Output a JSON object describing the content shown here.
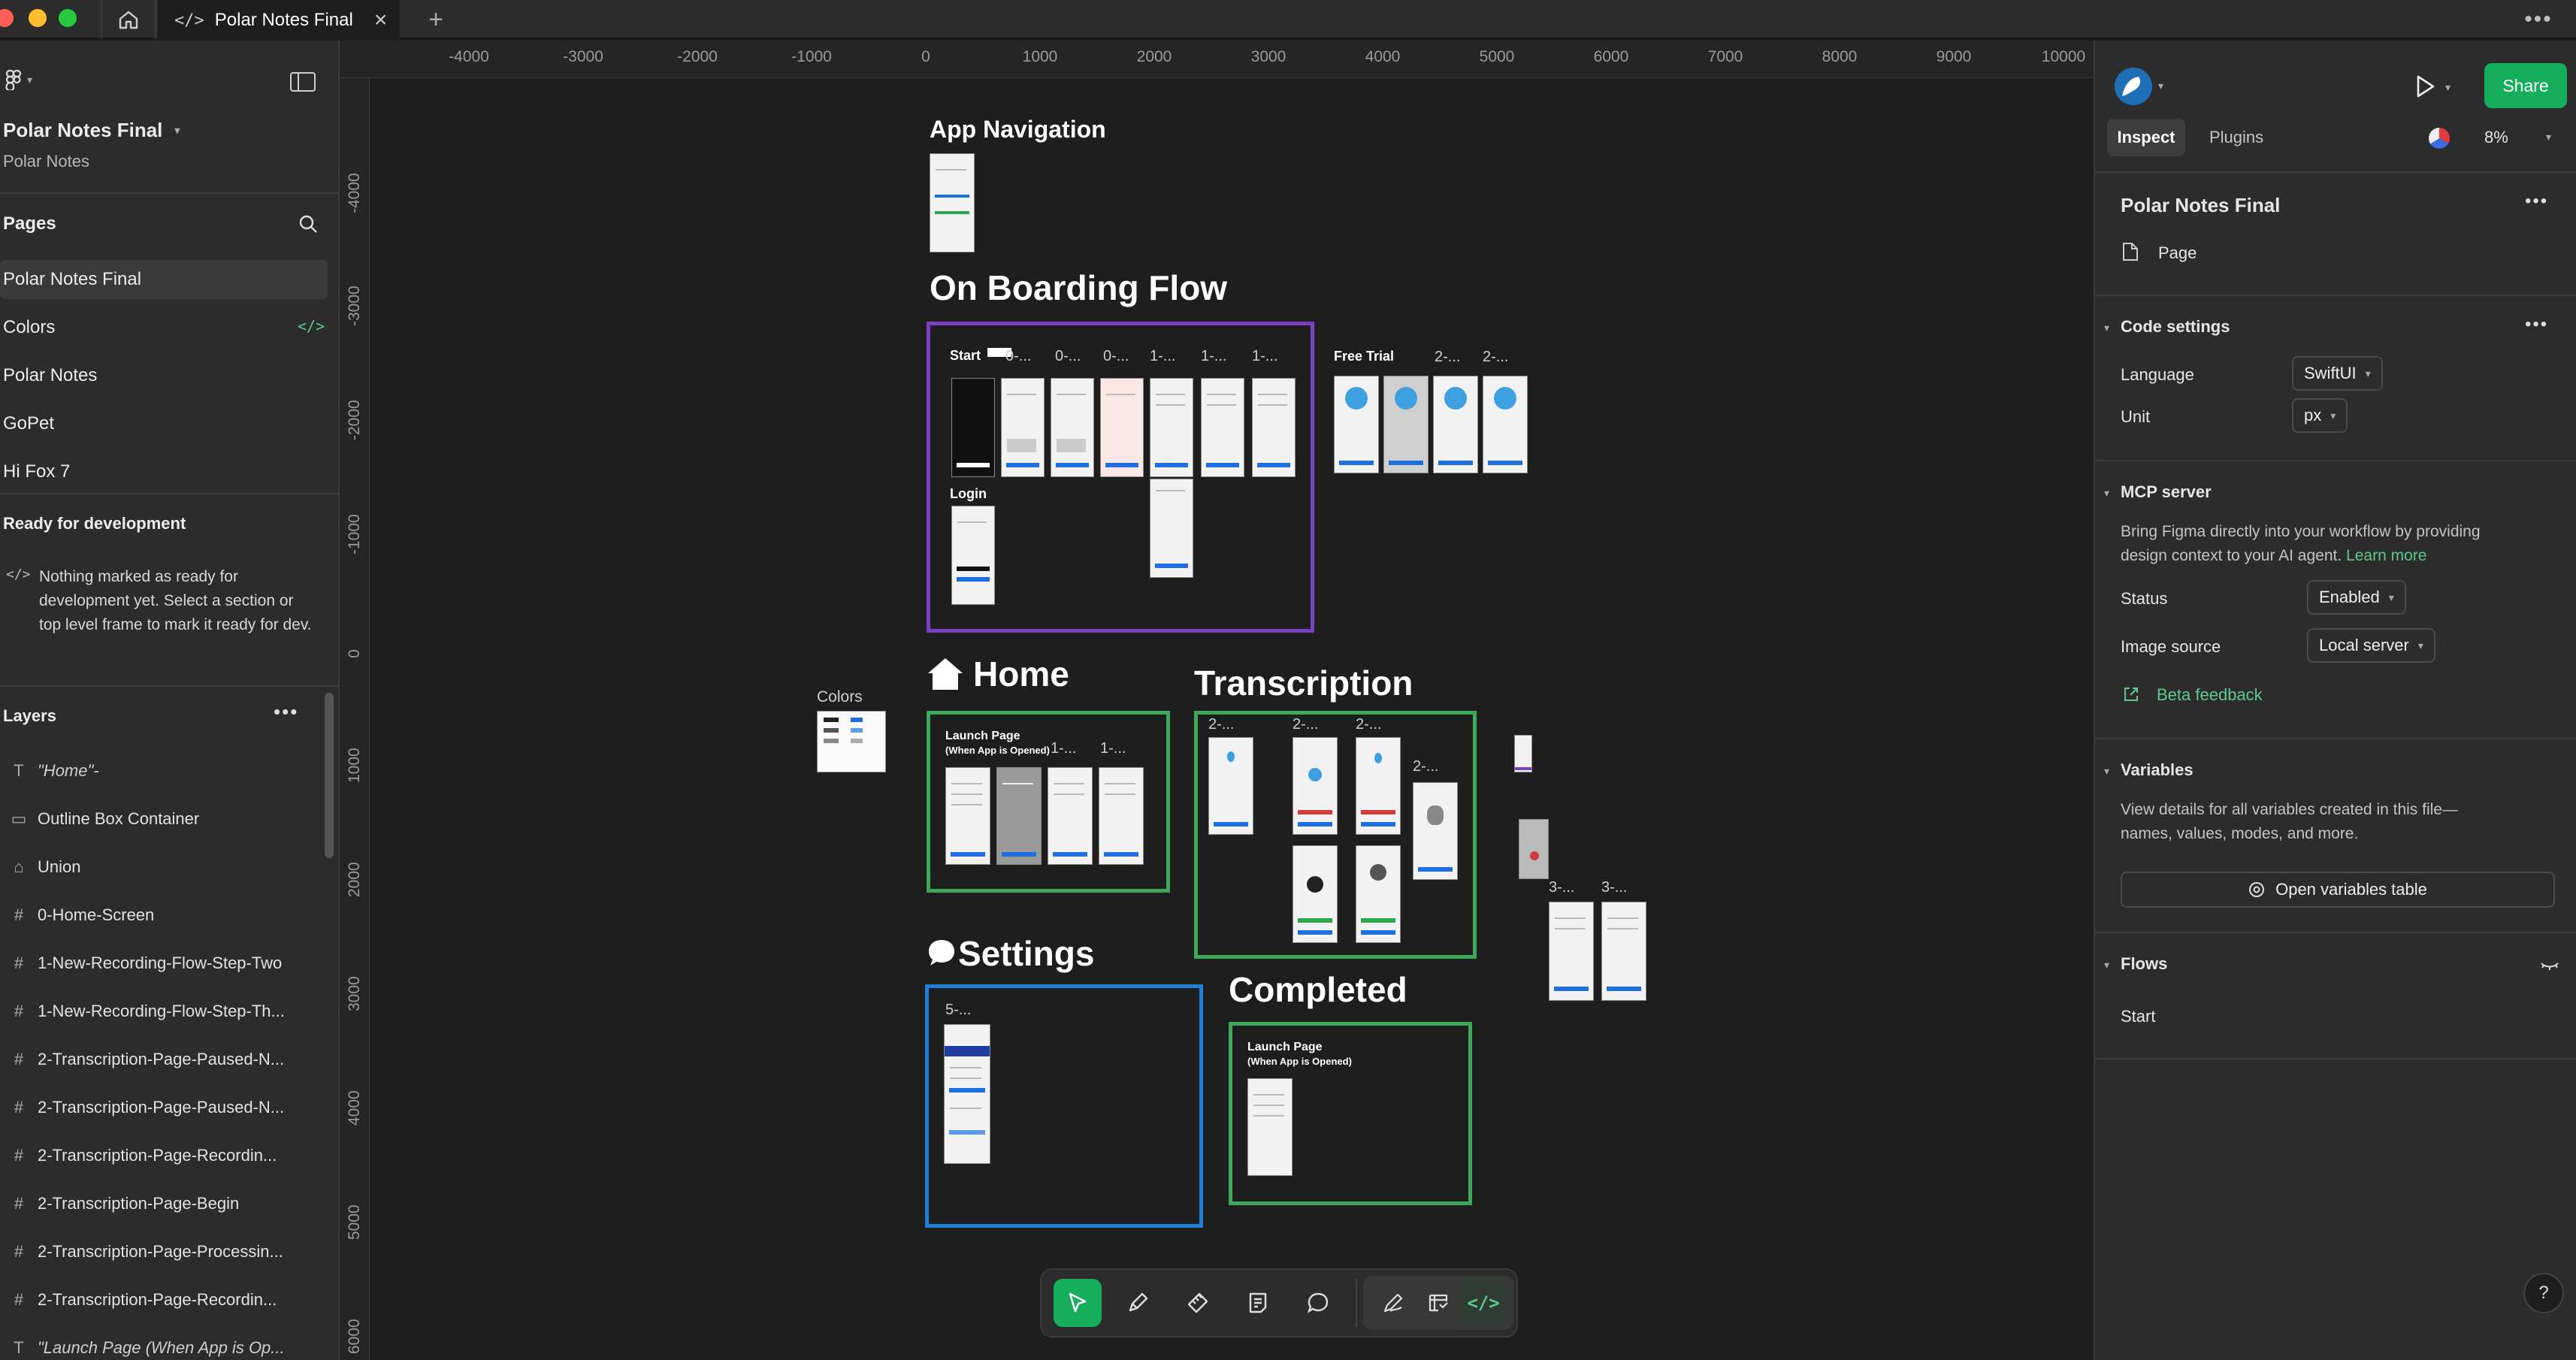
{
  "window": {
    "tab_title": "Polar Notes Final",
    "menu_dots": "•••"
  },
  "left": {
    "file_name": "Polar Notes Final",
    "project_name": "Polar Notes",
    "pages_header": "Pages",
    "pages": [
      "Polar Notes Final",
      "Colors",
      "Polar Notes",
      "GoPet",
      "Hi Fox 7"
    ],
    "ready_header": "Ready for development",
    "ready_message": "Nothing marked as ready for development yet. Select a section or top level frame to mark it ready for dev.",
    "layers_header": "Layers",
    "layers": [
      {
        "icon": "text-icon",
        "glyph": "T",
        "name": "\"Home\"-",
        "italic": true
      },
      {
        "icon": "rectangle-icon",
        "glyph": "▭",
        "name": "Outline Box Container",
        "italic": false
      },
      {
        "icon": "union-icon",
        "glyph": "⌂",
        "name": "Union",
        "italic": false
      },
      {
        "icon": "frame-icon",
        "glyph": "#",
        "name": "0-Home-Screen",
        "italic": false
      },
      {
        "icon": "frame-icon",
        "glyph": "#",
        "name": "1-New-Recording-Flow-Step-Two",
        "italic": false
      },
      {
        "icon": "frame-icon",
        "glyph": "#",
        "name": "1-New-Recording-Flow-Step-Th...",
        "italic": false
      },
      {
        "icon": "frame-icon",
        "glyph": "#",
        "name": "2-Transcription-Page-Paused-N...",
        "italic": false
      },
      {
        "icon": "frame-icon",
        "glyph": "#",
        "name": "2-Transcription-Page-Paused-N...",
        "italic": false
      },
      {
        "icon": "frame-icon",
        "glyph": "#",
        "name": "2-Transcription-Page-Recordin...",
        "italic": false
      },
      {
        "icon": "frame-icon",
        "glyph": "#",
        "name": "2-Transcription-Page-Begin",
        "italic": false
      },
      {
        "icon": "frame-icon",
        "glyph": "#",
        "name": "2-Transcription-Page-Processin...",
        "italic": false
      },
      {
        "icon": "frame-icon",
        "glyph": "#",
        "name": "2-Transcription-Page-Recordin...",
        "italic": false
      },
      {
        "icon": "text-icon",
        "glyph": "T",
        "name": "\"Launch Page (When App is Op...",
        "italic": true
      }
    ]
  },
  "rulers": {
    "top": [
      "-4000",
      "-3000",
      "-2000",
      "-1000",
      "0",
      "1000",
      "2000",
      "3000",
      "4000",
      "5000",
      "6000",
      "7000",
      "8000",
      "9000",
      "10000"
    ],
    "left": [
      "-4000",
      "-3000",
      "-2000",
      "-1000",
      "0",
      "1000",
      "2000",
      "3000",
      "4000",
      "5000",
      "6000"
    ]
  },
  "canvas": {
    "app_navigation": "App Navigation",
    "onboarding": "On Boarding Flow",
    "home": "Home",
    "transcription": "Transcription",
    "settings": "Settings",
    "completed": "Completed",
    "colors": "Colors",
    "start_label": "Start",
    "login_label": "Login",
    "free_trial": "Free Trial",
    "launch_page": "Launch Page",
    "when_opened": "(When App is Opened)",
    "onboarding_frame_labels": [
      "0-...",
      "0-...",
      "1-...",
      "1-...",
      "1-..."
    ],
    "free_trial_frame_labels": [
      "2-...",
      "2-..."
    ],
    "home_frame_labels": [
      "1-...",
      "1-..."
    ],
    "transcription_frame_labels": [
      "2-...",
      "2-...",
      "2-...",
      "2-..."
    ],
    "side_frame_labels": [
      "3-...",
      "3-..."
    ],
    "settings_frame_label": "5-...",
    "section_colors": {
      "onboarding": "#7b3fc4",
      "home": "#3fa75a",
      "transcription": "#3fa75a",
      "settings": "#1d7fd6",
      "completed": "#3fa75a"
    }
  },
  "toolbar": {
    "tools": [
      "move-tool-icon",
      "pen-tool-icon",
      "ruler-tool-icon",
      "annotation-tool-icon",
      "comment-tool-icon",
      "draw-tool-icon",
      "dev-resources-icon",
      "code-view-icon"
    ]
  },
  "right": {
    "share_label": "Share",
    "tab_inspect": "Inspect",
    "tab_plugins": "Plugins",
    "zoom": "8%",
    "selection_name": "Polar Notes Final",
    "selection_type": "Page",
    "code_settings_header": "Code settings",
    "language_label": "Language",
    "language_value": "SwiftUI",
    "unit_label": "Unit",
    "unit_value": "px",
    "mcp_header": "MCP server",
    "mcp_desc_1": "Bring Figma directly into your workflow by providing",
    "mcp_desc_2": "design context to your AI agent.",
    "learn_more": "Learn more",
    "status_label": "Status",
    "status_value": "Enabled",
    "image_source_label": "Image source",
    "image_source_value": "Local server",
    "beta_feedback": "Beta feedback",
    "variables_header": "Variables",
    "variables_desc_1": "View details for all variables created in this file—",
    "variables_desc_2": "names, values, modes, and more.",
    "open_variables": "Open variables table",
    "flows_header": "Flows",
    "flow_start": "Start",
    "help": "?"
  },
  "colors": {
    "accent_green": "#14ae5c",
    "link_green": "#5ec98a",
    "onboarding_purple": "#7b3fc4",
    "section_green": "#3fa75a",
    "settings_blue": "#1d7fd6"
  }
}
